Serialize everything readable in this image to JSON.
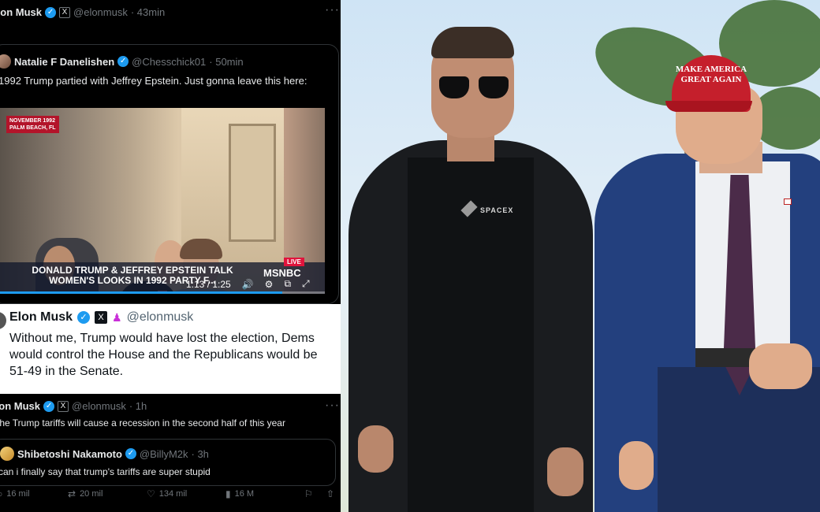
{
  "tweet_top": {
    "name": "Elon Musk",
    "handle": "@elonmusk",
    "time": "· 43min",
    "more": "···"
  },
  "quoted": {
    "name": "Natalie F Danelishen",
    "handle": "@Chesschick01",
    "time": "· 50min",
    "text": "1992 Trump partied with Jeffrey Epstein. Just gonna leave this here:"
  },
  "video": {
    "location_tag": "NOVEMBER 1992\nPALM BEACH, FL",
    "chyron": "DONALD TRUMP & JEFFREY EPSTEIN TALK\nWOMEN'S LOOKS IN 1992 PARTY F...",
    "live": "LIVE",
    "network": "MSNBC",
    "timecode": "1:13 / 1:25",
    "progress": 0.87
  },
  "light_tweet": {
    "name": "Elon Musk",
    "handle": "@elonmusk",
    "text": "Without me, Trump would have lost the election, Dems would control the House and the Republicans would be 51-49 in the Senate."
  },
  "tweet_bottom": {
    "name": "Elon Musk",
    "handle": "@elonmusk",
    "time": "· 1h",
    "more": "···",
    "text": "The Trump tariffs will cause a recession in the second half of this year"
  },
  "quoted2": {
    "name": "Shibetoshi Nakamoto",
    "handle": "@BillyM2k",
    "time": "· 3h",
    "text": "can i finally say that trump's tariffs are super stupid"
  },
  "actions": {
    "replies": "16 mil",
    "retweets": "20 mil",
    "likes": "134 mil",
    "views": "16 M"
  },
  "photo": {
    "cap_text": "MAKE AMERICA\nGREAT AGAIN",
    "shirt_text": "SPACEX"
  },
  "colors": {
    "verified": "#1d9bf0",
    "dark_bg": "#000000",
    "cap_red": "#c51f2c"
  }
}
